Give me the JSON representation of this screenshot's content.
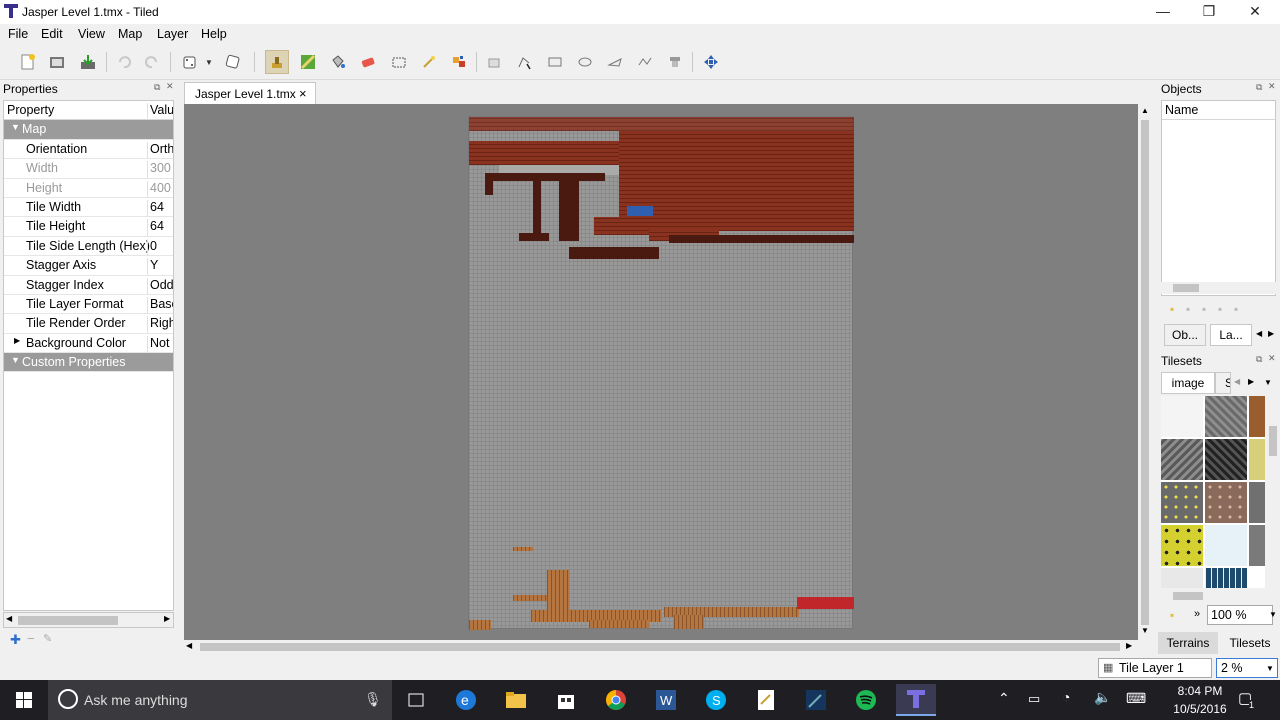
{
  "window": {
    "title": "Jasper Level 1.tmx - Tiled",
    "controls": {
      "minimize": "—",
      "maximize": "❐",
      "close": "✕"
    }
  },
  "menu": [
    "File",
    "Edit",
    "View",
    "Map",
    "Layer",
    "Help"
  ],
  "properties": {
    "title": "Properties",
    "header": {
      "property": "Property",
      "value": "Value"
    },
    "map_group": "Map",
    "rows": [
      {
        "key": "Orientation",
        "value": "Orth",
        "disabled": false
      },
      {
        "key": "Width",
        "value": "300",
        "disabled": true
      },
      {
        "key": "Height",
        "value": "400",
        "disabled": true
      },
      {
        "key": "Tile Width",
        "value": "64",
        "disabled": false
      },
      {
        "key": "Tile Height",
        "value": "64",
        "disabled": false
      },
      {
        "key": "Tile Side Length (Hex)",
        "value": "0",
        "disabled": false
      },
      {
        "key": "Stagger Axis",
        "value": "Y",
        "disabled": false
      },
      {
        "key": "Stagger Index",
        "value": "Odd",
        "disabled": false
      },
      {
        "key": "Tile Layer Format",
        "value": "Base",
        "disabled": false
      },
      {
        "key": "Tile Render Order",
        "value": "Righ",
        "disabled": false
      },
      {
        "key": "Background Color",
        "value": "Not :",
        "disabled": false
      }
    ],
    "custom_group": "Custom Properties"
  },
  "editor": {
    "tab_label": "Jasper Level 1.tmx",
    "tab_close": "×"
  },
  "objects": {
    "title": "Objects",
    "column": "Name",
    "tabs": [
      "Ob...",
      "La..."
    ]
  },
  "tilesets": {
    "title": "Tilesets",
    "tab_active": "image",
    "tab_next": "S",
    "zoom": "100 %",
    "bottom_tabs": [
      "Terrains",
      "Tilesets"
    ]
  },
  "status": {
    "layer": "Tile Layer 1",
    "zoom": "2 %"
  },
  "taskbar": {
    "search_placeholder": "Ask me anything",
    "time": "8:04 PM",
    "date": "10/5/2016",
    "notification_count": "1"
  },
  "colors": {
    "brick": "#7a2a18",
    "dirt": "#a46633",
    "accent_blue": "#2f5fb0",
    "hazard_red": "#c0262a"
  }
}
